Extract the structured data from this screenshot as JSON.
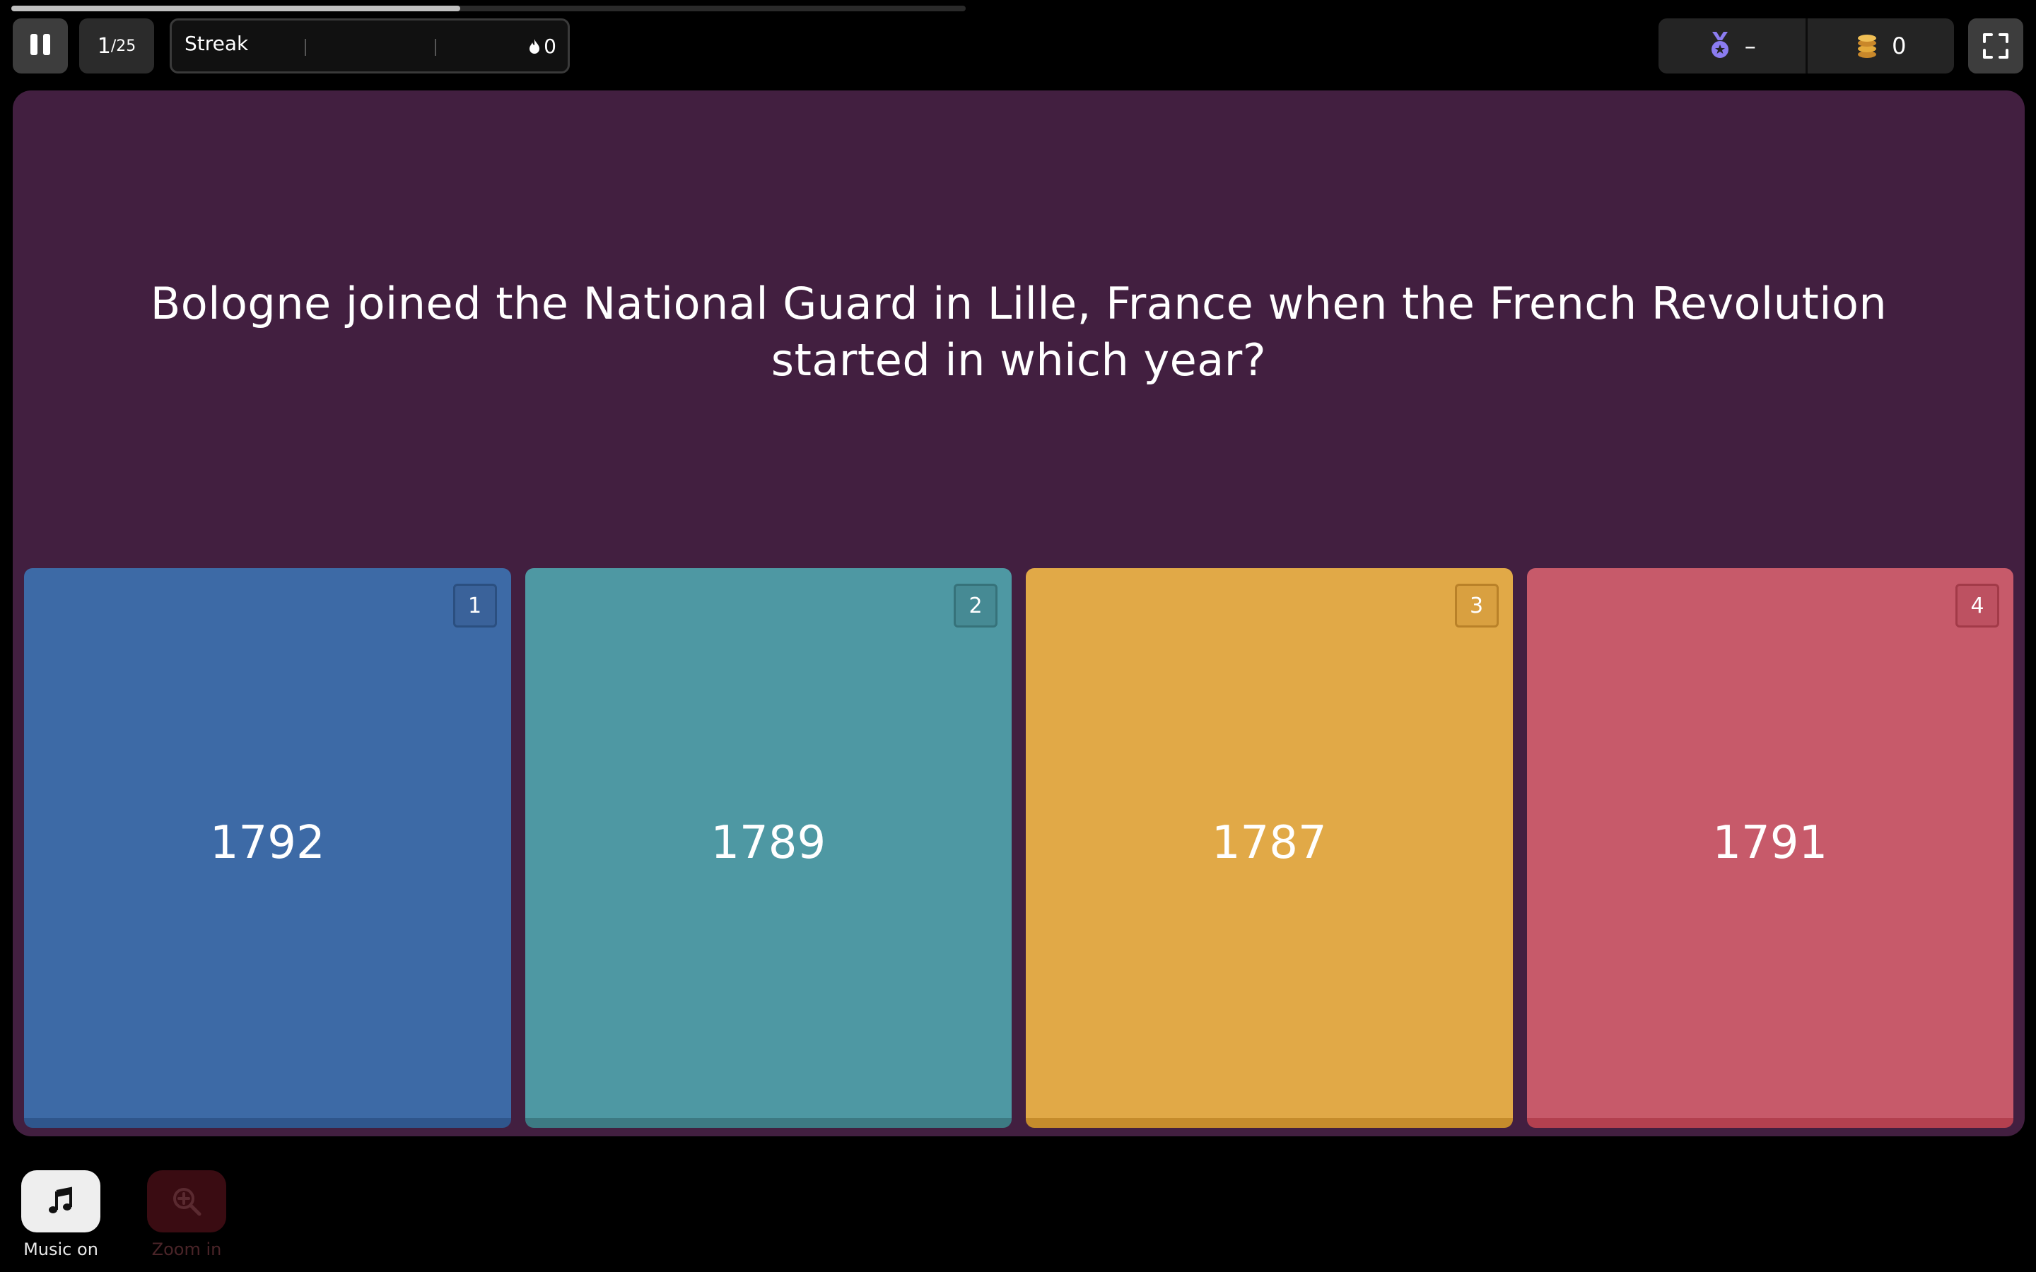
{
  "progress": {
    "fraction": 0.47
  },
  "topbar": {
    "counter_current": "1",
    "counter_total": "/25",
    "streak_label": "Streak",
    "streak_value": "0",
    "rank_value": "–",
    "coins_value": "0"
  },
  "question": {
    "text": "Bologne joined the National Guard in Lille, France when the French Revolution started in which year?"
  },
  "answers": [
    {
      "key": "1",
      "label": "1792",
      "color": "#3d6aa6"
    },
    {
      "key": "2",
      "label": "1789",
      "color": "#4e98a3"
    },
    {
      "key": "3",
      "label": "1787",
      "color": "#e1a947"
    },
    {
      "key": "4",
      "label": "1791",
      "color": "#c75a6a"
    }
  ],
  "tools": {
    "music_label": "Music on",
    "zoom_label": "Zoom in"
  },
  "colors": {
    "panel": "#421f40",
    "background": "#000000",
    "rank_icon": "#8b7cf0",
    "coin_icon": "#e3a93a"
  },
  "icons": [
    "pause-icon",
    "flame-icon",
    "medal-icon",
    "coins-icon",
    "fullscreen-icon",
    "music-note-icon",
    "zoom-in-icon"
  ]
}
